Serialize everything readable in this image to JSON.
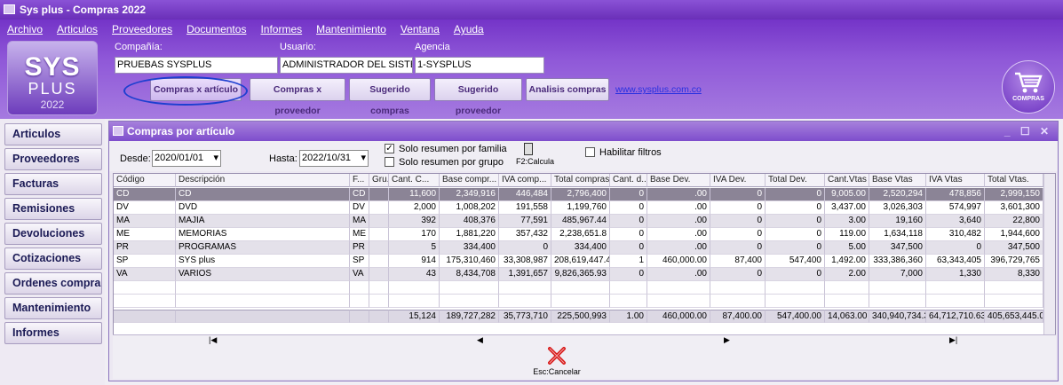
{
  "title": "Sys plus - Compras 2022",
  "menu": [
    "Archivo",
    "Articulos",
    "Proveedores",
    "Documentos",
    "Informes",
    "Mantenimiento",
    "Ventana",
    "Ayuda"
  ],
  "logo": {
    "line1": "SYS",
    "line2": "PLUS",
    "line3": "2022"
  },
  "fields": {
    "compania_label": "Compañía:",
    "compania_value": "PRUEBAS SYSPLUS",
    "usuario_label": "Usuario:",
    "usuario_value": "ADMINISTRADOR DEL SISTEM",
    "agencia_label": "Agencia",
    "agencia_value": "1-SYSPLUS"
  },
  "toolbar": [
    "Compras x artículo",
    "Compras x proveedor",
    "Sugerido compras",
    "Sugerido proveedor",
    "Analisis compras"
  ],
  "weblink": "www.sysplus.com.co",
  "cart_label": "COMPRAS",
  "sidebar": [
    "Articulos",
    "Proveedores",
    "Facturas",
    "Remisiones",
    "Devoluciones",
    "Cotizaciones",
    "Ordenes compra",
    "Mantenimiento",
    "Informes"
  ],
  "window": {
    "title": "Compras por artículo",
    "desde_label": "Desde:",
    "desde_value": "2020/01/01",
    "hasta_label": "Hasta:",
    "hasta_value": "2022/10/31",
    "opt_familia": "Solo resumen por familia",
    "opt_familia_checked": true,
    "opt_grupo": "Solo resumen por grupo",
    "opt_grupo_checked": false,
    "calc_label": "F2:Calcula",
    "habilitar": "Habilitar filtros",
    "habilitar_checked": false,
    "cancel_label": "Esc:Cancelar"
  },
  "columns": [
    "Código",
    "Descripción",
    "F...",
    "Gru...",
    "Cant. C...",
    "Base compr...",
    "IVA comp...",
    "Total compras",
    "Cant. d...",
    "Base Dev.",
    "IVA Dev.",
    "Total Dev.",
    "Cant.Vtas",
    "Base Vtas",
    "IVA Vtas",
    "Total Vtas."
  ],
  "rows": [
    [
      "CD",
      "CD",
      "CD",
      "",
      "11,600",
      "2,349,916",
      "446,484",
      "2,796,400",
      "0",
      ".00",
      "0",
      "0",
      "9,005.00",
      "2,520,294",
      "478,856",
      "2,999,150"
    ],
    [
      "DV",
      "DVD",
      "DV",
      "",
      "2,000",
      "1,008,202",
      "191,558",
      "1,199,760",
      "0",
      ".00",
      "0",
      "0",
      "3,437.00",
      "3,026,303",
      "574,997",
      "3,601,300"
    ],
    [
      "MA",
      "MAJIA",
      "MA",
      "",
      "392",
      "408,376",
      "77,591",
      "485,967.44",
      "0",
      ".00",
      "0",
      "0",
      "3.00",
      "19,160",
      "3,640",
      "22,800"
    ],
    [
      "ME",
      "MEMORIAS",
      "ME",
      "",
      "170",
      "1,881,220",
      "357,432",
      "2,238,651.8",
      "0",
      ".00",
      "0",
      "0",
      "119.00",
      "1,634,118",
      "310,482",
      "1,944,600"
    ],
    [
      "PR",
      "PROGRAMAS",
      "PR",
      "",
      "5",
      "334,400",
      "0",
      "334,400",
      "0",
      ".00",
      "0",
      "0",
      "5.00",
      "347,500",
      "0",
      "347,500"
    ],
    [
      "SP",
      "SYS plus",
      "SP",
      "",
      "914",
      "175,310,460",
      "33,308,987",
      "208,619,447.4",
      "1",
      "460,000.00",
      "87,400",
      "547,400",
      "1,492.00",
      "333,386,360",
      "63,343,405",
      "396,729,765"
    ],
    [
      "VA",
      "VARIOS",
      "VA",
      "",
      "43",
      "8,434,708",
      "1,391,657",
      "9,826,365.93",
      "0",
      ".00",
      "0",
      "0",
      "2.00",
      "7,000",
      "1,330",
      "8,330"
    ]
  ],
  "totals": [
    "",
    "",
    "",
    "",
    "15,124",
    "189,727,282",
    "35,773,710",
    "225,500,993",
    "1.00",
    "460,000.00",
    "87,400.00",
    "547,400.00",
    "14,063.00",
    "340,940,734.37",
    "64,712,710.63",
    "405,653,445.00"
  ]
}
